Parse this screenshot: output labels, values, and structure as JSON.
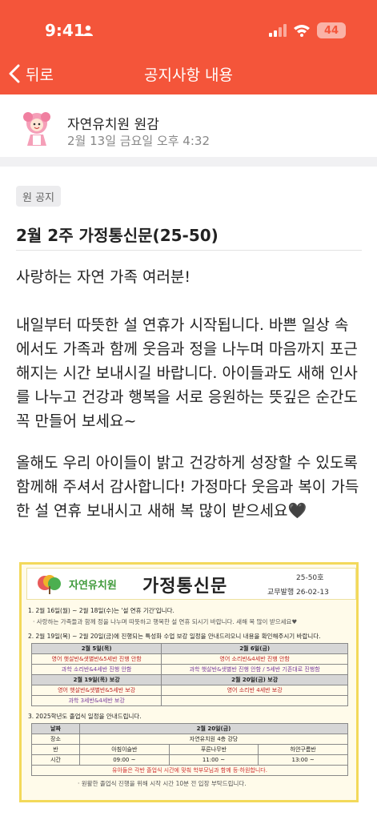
{
  "status": {
    "time": "9:41",
    "battery": "44"
  },
  "nav": {
    "back_label": "뒤로",
    "title": "공지사항 내용"
  },
  "author": {
    "name": "자연유치원 원감",
    "date": "2월 13일 금요일 오후 4:32"
  },
  "post": {
    "tag": "원 공지",
    "title": "2월 2주 가정통신문(25-50)",
    "paragraphs": [
      "사랑하는 자연 가족 여러분!",
      "내일부터 따뜻한 설 연휴가 시작됩니다. 바쁜 일상 속에서도 가족과 함께 웃음과 정을 나누며 마음까지 포근해지는 시간 보내시길 바랍니다. 아이들과도 새해 인사를 나누고 건강과 행복을 서로 응원하는 뜻깊은 순간도 꼭 만들어 보세요~",
      "올해도 우리 아이들이 밝고 건강하게 성장할 수 있도록 함께해 주셔서 감사합니다! 가정마다 웃음과 복이 가득한 설 연휴 보내시고 새해 복 많이 받으세요🖤"
    ]
  },
  "newsletter": {
    "logo_text": "자연유치원",
    "title": "가정통신문",
    "issue": "25-50호",
    "issuer": "교무발행  26-02-13",
    "item1": "1. 2월 16일(월) ~ 2월 18일(수)는 '설 연휴 기간'입니다.",
    "item1_sub": "· 사랑하는 가족들과 함께 정을 나누며 따뜻하고 행복한 설 연휴 되시기 바랍니다. 새해 복 많이 받으세요♥",
    "item2": "2. 2월 19일(목) ~ 2월 20일(금)에 진행되는 특성화 수업 보강 일정을 안내드리오니 내용을 확인해주시기 바랍니다.",
    "makeup_table": {
      "headers": [
        "2월 5일(목)",
        "2월 6일(금)"
      ],
      "row1": [
        "영어 햇살반&샛별반&5세반 진행 안함",
        "영어 소리반&4세반 진행 안함"
      ],
      "row1b": [
        "과학 소리반&4세반 진행 안함",
        "과학 햇살반&샛별반 진행 안함 / 5세반 기존대로 진행함"
      ],
      "headers2": [
        "2월 19일(목) 보강",
        "2월 20일(금) 보강"
      ],
      "row2": [
        "영어 햇살반&샛별반&5세반 보강",
        "영어 소리반 4세반 보강"
      ],
      "row2b": [
        "과학 3세반&4세반 보강",
        ""
      ]
    },
    "item3": "3. 2025학년도 졸업식 일정을 안내드립니다.",
    "grad_table": {
      "date_label": "날짜",
      "date": "2월 20일(금)",
      "place_label": "장소",
      "place": "자연유치원 4층 강당",
      "class_label": "반",
      "classes": [
        "아침이슬반",
        "푸른나무반",
        "하얀구름반"
      ],
      "time_label": "시간",
      "times": [
        "09:00 ~",
        "11:00 ~",
        "13:00 ~"
      ],
      "note": "유아들은 각반 졸업식 시간에 맞춰 학부모님과 함께 등·하원합니다."
    },
    "bullet": "· 원활한 졸업식 진행을 위해 시작 시간 10분 전 입장 부탁드립니다."
  },
  "colors": {
    "accent": "#f4553a",
    "newsletter_border": "#f3d95a"
  }
}
